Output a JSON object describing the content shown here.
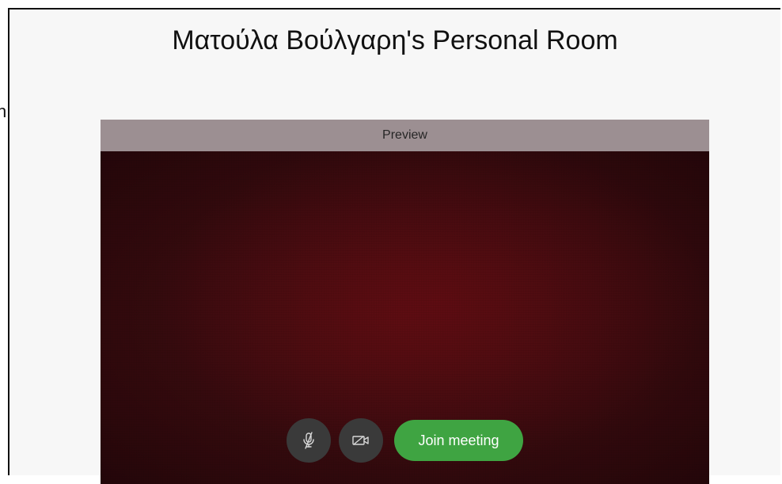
{
  "left_edge": {
    "text": "n"
  },
  "room": {
    "title": "Ματούλα Βούλγαρη's Personal Room"
  },
  "preview": {
    "header": "Preview"
  },
  "controls": {
    "mute_icon": "microphone-muted-icon",
    "video_icon": "video-off-icon",
    "join_label": "Join meeting",
    "join_color": "#3fa442",
    "button_color": "#3a3a3a"
  }
}
